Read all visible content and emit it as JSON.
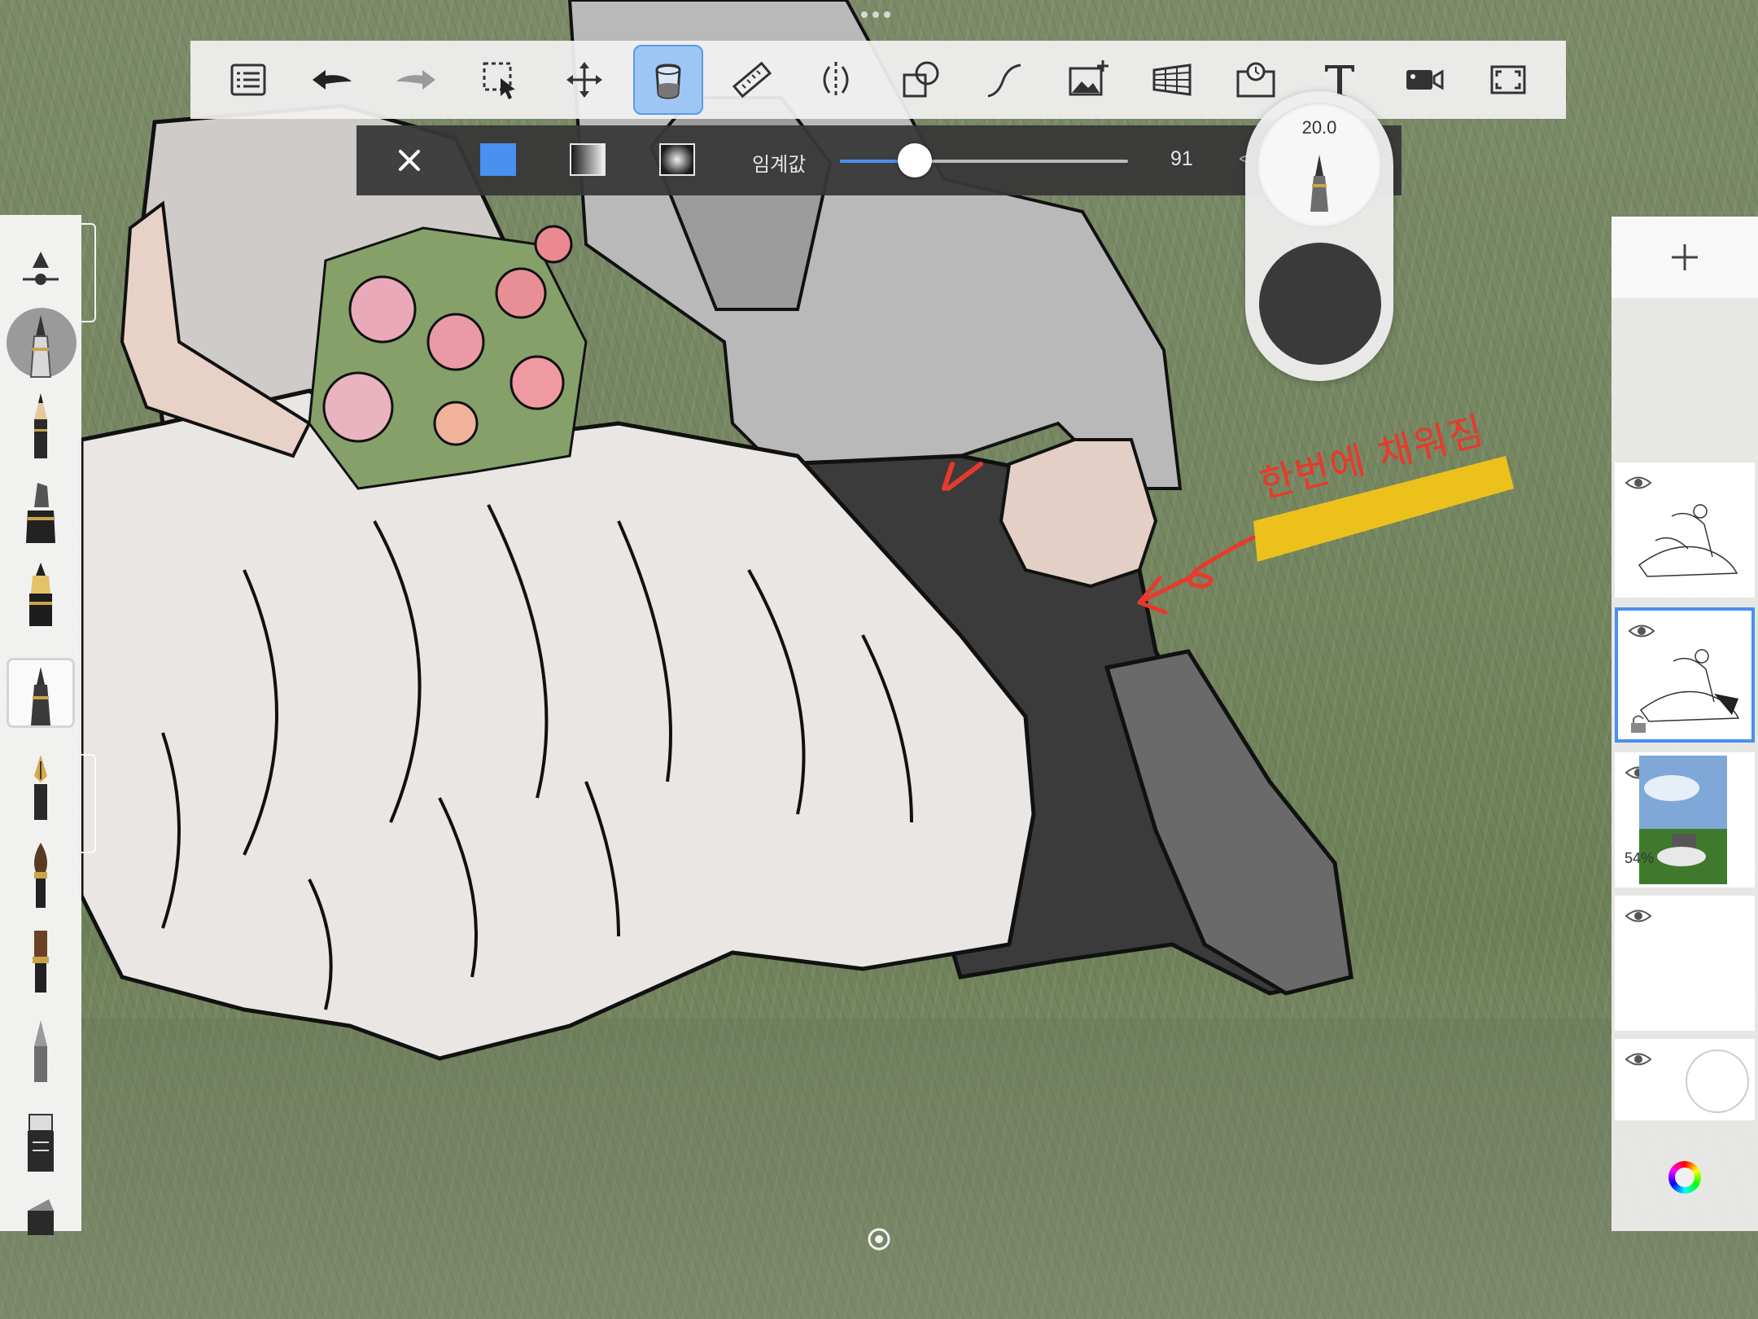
{
  "toolbar": {
    "items": [
      {
        "name": "layers-list",
        "icon": "list-icon"
      },
      {
        "name": "undo",
        "icon": "undo-arrow-icon"
      },
      {
        "name": "redo",
        "icon": "redo-arrow-icon"
      },
      {
        "name": "selection",
        "icon": "selection-arrow-icon"
      },
      {
        "name": "transform",
        "icon": "move-arrows-icon"
      },
      {
        "name": "fill",
        "icon": "paint-bucket-icon",
        "active": true
      },
      {
        "name": "ruler",
        "icon": "ruler-icon"
      },
      {
        "name": "symmetry",
        "icon": "symmetry-icon"
      },
      {
        "name": "shapes",
        "icon": "shapes-icon"
      },
      {
        "name": "stroke",
        "icon": "curve-stroke-icon"
      },
      {
        "name": "import-image",
        "icon": "image-add-icon"
      },
      {
        "name": "perspective",
        "icon": "perspective-grid-icon"
      },
      {
        "name": "time-lapse",
        "icon": "timelapse-icon"
      },
      {
        "name": "text",
        "icon": "text-icon"
      },
      {
        "name": "record",
        "icon": "video-camera-icon"
      },
      {
        "name": "fullscreen",
        "icon": "fullscreen-icon"
      }
    ]
  },
  "fill_options": {
    "close_icon": "close-icon",
    "modes": [
      "solid-fill",
      "linear-gradient-fill",
      "radial-gradient-fill"
    ],
    "selected_mode": "solid-fill",
    "threshold_label": "임계값",
    "threshold_value": "91",
    "threshold_fraction": 0.26,
    "accent_color": "#4a90f0"
  },
  "brush_puck": {
    "size_value": "20.0",
    "current_color": "#3a3a3a"
  },
  "brush_palette": {
    "brushes": [
      "brush-settings",
      "pencil-selected",
      "pencil",
      "marker",
      "ink-pen",
      "fineliner",
      "fountain-pen",
      "round-brush",
      "flat-brush",
      "airbrush",
      "eraser",
      "chisel"
    ],
    "selected": "pencil-selected"
  },
  "layers": {
    "add_icon": "plus-icon",
    "items": [
      {
        "name": "line-art-layer",
        "visible": true,
        "selected": false
      },
      {
        "name": "fill-layer",
        "visible": true,
        "selected": true,
        "locked": true
      },
      {
        "name": "photo-layer",
        "visible": true,
        "opacity": "54%"
      },
      {
        "name": "empty-layer",
        "visible": true
      },
      {
        "name": "background-layer",
        "visible": true
      }
    ],
    "color_wheel_icon": "color-wheel-icon"
  },
  "annotation": {
    "text": "한번에 채워짐",
    "highlight_color": "#f5c518",
    "ink_color": "#e8392c"
  }
}
